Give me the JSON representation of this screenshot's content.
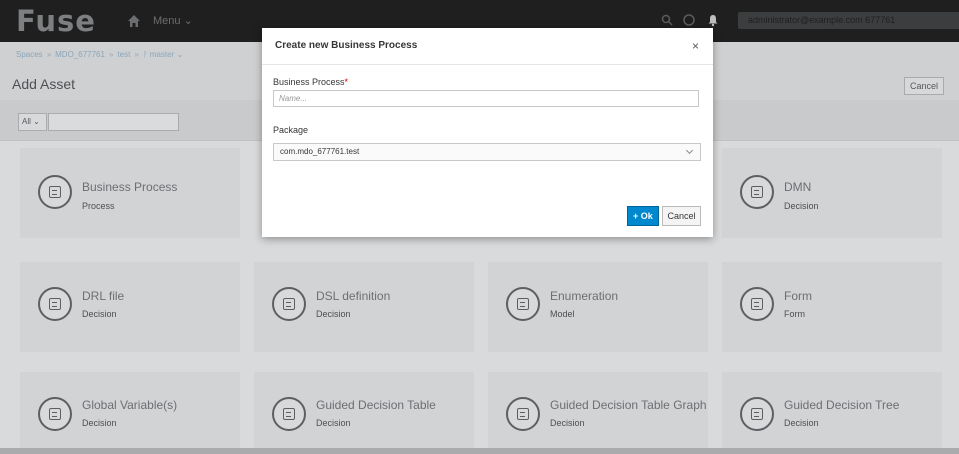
{
  "navbar": {
    "brand": "Fuse",
    "menu_label": "Menu",
    "user_label": "administrator@example.com 677761"
  },
  "breadcrumb": {
    "items": [
      "Spaces",
      "MDO_677761",
      "test",
      "master"
    ]
  },
  "page": {
    "title": "Add Asset",
    "cancel_label": "Cancel"
  },
  "filter": {
    "select_value": "All",
    "search_value": ""
  },
  "cards": [
    {
      "name": "Business Process",
      "category": "Process",
      "icon": "process-icon"
    },
    {
      "name": "DMN",
      "category": "Decision",
      "icon": "dmn-icon"
    },
    {
      "name": "DRL file",
      "category": "Decision",
      "icon": "drl-icon"
    },
    {
      "name": "DSL definition",
      "category": "Decision",
      "icon": "dsl-icon"
    },
    {
      "name": "Enumeration",
      "category": "Model",
      "icon": "enumeration-icon"
    },
    {
      "name": "Form",
      "category": "Form",
      "icon": "form-icon"
    },
    {
      "name": "Global Variable(s)",
      "category": "Decision",
      "icon": "global-variable-icon"
    },
    {
      "name": "Guided Decision Table",
      "category": "Decision",
      "icon": "guided-decision-table-icon"
    },
    {
      "name": "Guided Decision Table Graph",
      "category": "Decision",
      "icon": "guided-decision-table-graph-icon"
    },
    {
      "name": "Guided Decision Tree",
      "category": "Decision",
      "icon": "guided-decision-tree-icon"
    }
  ],
  "modal": {
    "title": "Create new Business Process",
    "close_glyph": "×",
    "name_label": "Business Process",
    "required_marker": "*",
    "name_placeholder": "Name...",
    "name_value": "",
    "package_label": "Package",
    "package_value": "com.mdo_677761.test",
    "ok_label": "+ Ok",
    "cancel_label": "Cancel"
  }
}
